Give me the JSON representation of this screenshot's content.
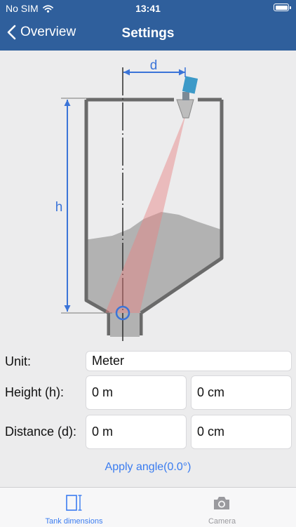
{
  "status_bar": {
    "carrier": "No SIM",
    "time": "13:41"
  },
  "nav": {
    "back_label": "Overview",
    "title": "Settings"
  },
  "diagram": {
    "distance_label": "d",
    "height_label": "h"
  },
  "form": {
    "unit_label": "Unit:",
    "unit_value": "Meter",
    "height_label": "Height (h):",
    "height_m": "0 m",
    "height_cm": "0 cm",
    "distance_label": "Distance (d):",
    "distance_m": "0 m",
    "distance_cm": "0 cm",
    "apply_label": "Apply angle(0.0°)"
  },
  "tabs": [
    {
      "label": "Tank dimensions",
      "active": true
    },
    {
      "label": "Camera",
      "active": false
    }
  ],
  "colors": {
    "bar": "#2f5f9c",
    "accent": "#3a7cf0",
    "inactive": "#9a9a9e"
  }
}
